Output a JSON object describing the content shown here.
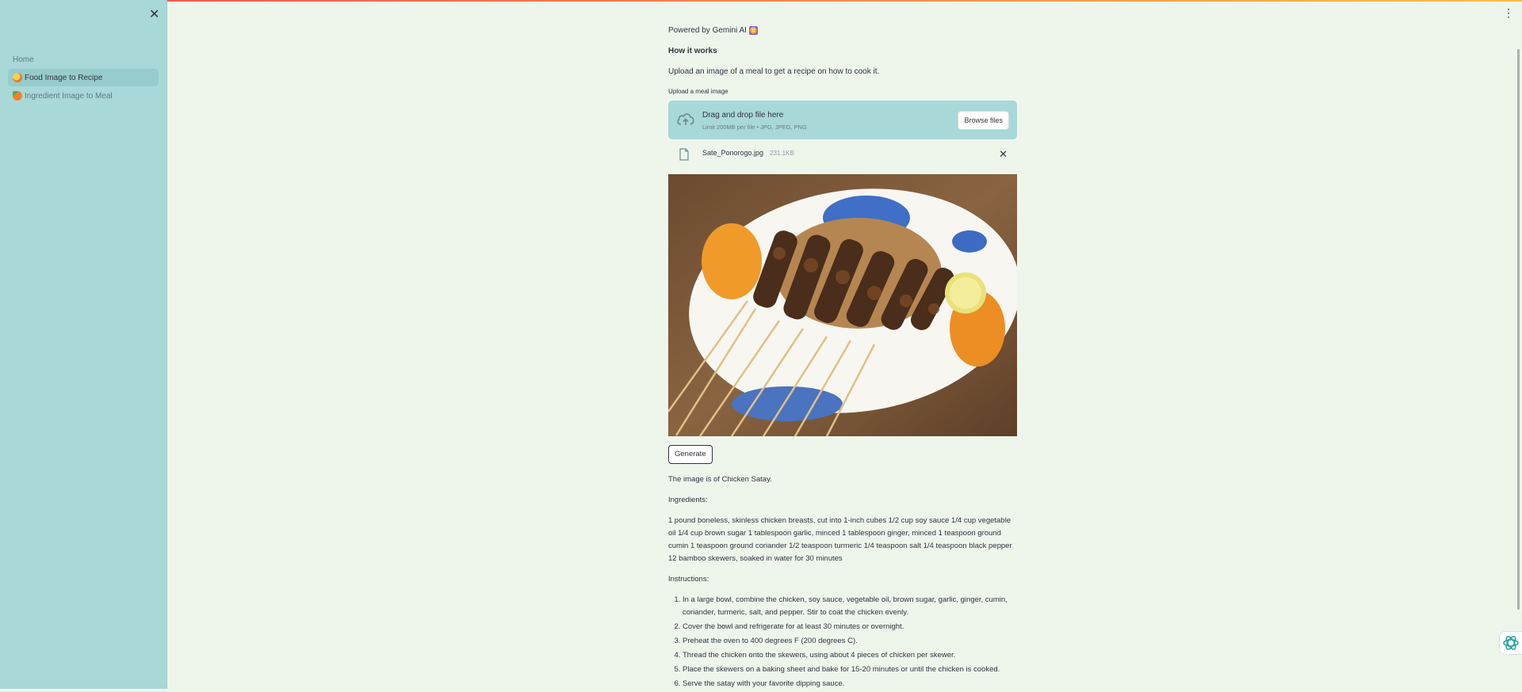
{
  "sidebar": {
    "items": [
      {
        "label": "Home"
      },
      {
        "label": "Food Image to Recipe",
        "icon": "pizza-icon",
        "active": true
      },
      {
        "label": "Ingredient Image to Meal",
        "icon": "carrot-icon"
      }
    ]
  },
  "header": {
    "powered_by": "Powered by Gemini AI",
    "badge": "♊"
  },
  "how_it_works": {
    "title": "How it works",
    "text": "Upload an image of a meal to get a recipe on how to cook it."
  },
  "uploader": {
    "label": "Upload a meal image",
    "drop_title": "Drag and drop file here",
    "limit": "Limit 200MB per file • JPG, JPEG, PNG",
    "browse_label": "Browse files",
    "file_name": "Sate_Ponorogo.jpg",
    "file_size": "231.1KB"
  },
  "generate_label": "Generate",
  "result": {
    "intro": "The image is of Chicken Satay.",
    "ingredients_heading": "Ingredients:",
    "ingredients": "1 pound boneless, skinless chicken breasts, cut into 1-inch cubes 1/2 cup soy sauce 1/4 cup vegetable oil 1/4 cup brown sugar 1 tablespoon garlic, minced 1 tablespoon ginger, minced 1 teaspoon ground cumin 1 teaspoon ground coriander 1/2 teaspoon turmeric 1/4 teaspoon salt 1/4 teaspoon black pepper 12 bamboo skewers, soaked in water for 30 minutes",
    "instructions_heading": "Instructions:",
    "steps": [
      "In a large bowl, combine the chicken, soy sauce, vegetable oil, brown sugar, garlic, ginger, cumin, coriander, turmeric, salt, and pepper. Stir to coat the chicken evenly.",
      "Cover the bowl and refrigerate for at least 30 minutes or overnight.",
      "Preheat the oven to 400 degrees F (200 degrees C).",
      "Thread the chicken onto the skewers, using about 4 pieces of chicken per skewer.",
      "Place the skewers on a baking sheet and bake for 15-20 minutes or until the chicken is cooked.",
      "Serve the satay with your favorite dipping sauce."
    ]
  },
  "colors": {
    "sidebar_bg": "#a8d8d8",
    "main_bg": "#eef6ec",
    "text": "#31333f",
    "dropzone_bg": "#a8d8d8"
  }
}
